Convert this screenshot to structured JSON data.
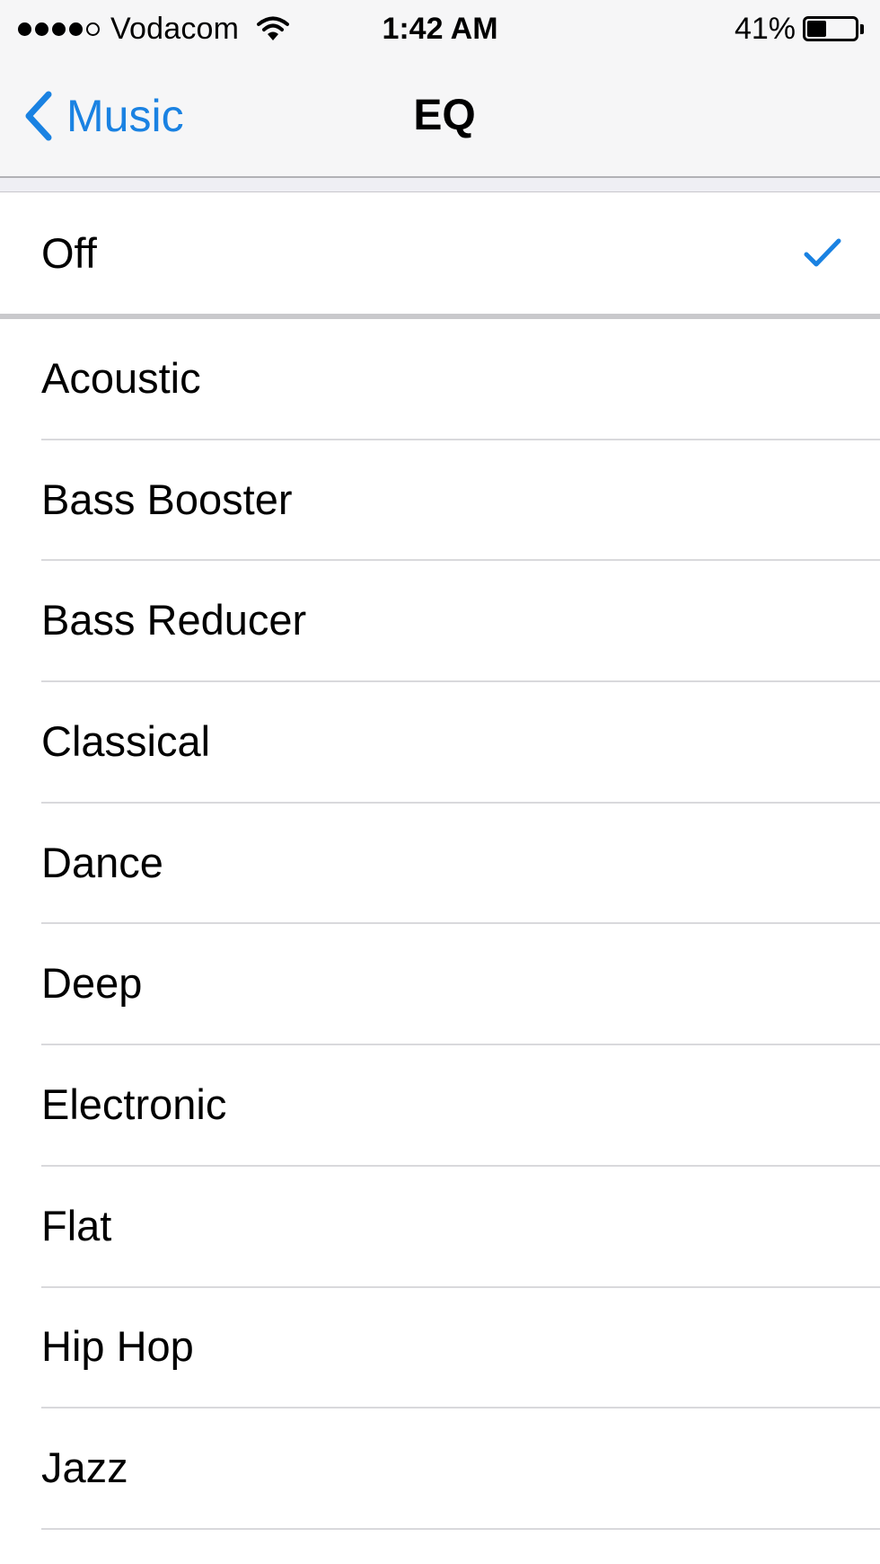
{
  "status_bar": {
    "signal_filled": 4,
    "signal_total": 5,
    "carrier": "Vodacom",
    "time": "1:42 AM",
    "battery_percent": "41%",
    "battery_level": 0.41,
    "wifi_icon": "wifi-icon",
    "battery_icon": "battery-icon"
  },
  "nav": {
    "back_label": "Music",
    "back_icon": "chevron-left-icon",
    "title": "EQ"
  },
  "colors": {
    "accent": "#1a82e2",
    "bar_background": "#f6f6f7",
    "group_background": "#efeff4",
    "separator": "#d9d9dc"
  },
  "off_option": {
    "label": "Off",
    "selected": true,
    "check_icon": "checkmark-icon"
  },
  "presets": [
    {
      "label": "Acoustic"
    },
    {
      "label": "Bass Booster"
    },
    {
      "label": "Bass Reducer"
    },
    {
      "label": "Classical"
    },
    {
      "label": "Dance"
    },
    {
      "label": "Deep"
    },
    {
      "label": "Electronic"
    },
    {
      "label": "Flat"
    },
    {
      "label": "Hip Hop"
    },
    {
      "label": "Jazz"
    }
  ]
}
